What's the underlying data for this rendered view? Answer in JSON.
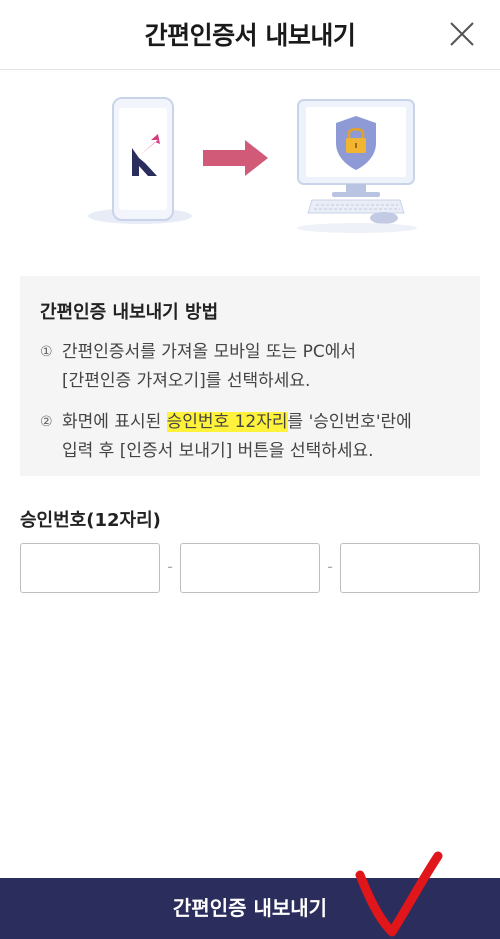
{
  "header": {
    "title": "간편인증서 내보내기",
    "close_icon": "close-icon"
  },
  "illustration": {
    "phone_logo_letter": "K",
    "arrow_icon": "arrow-right-icon",
    "computer_icon": "monitor-lock-icon",
    "colors": {
      "phone": "#eef2fb",
      "arrow": "#d05a78",
      "shield": "#8d9ad6",
      "lock": "#f1b532"
    }
  },
  "guide": {
    "title": "간편인증 내보내기 방법",
    "steps": [
      {
        "num": "①",
        "lines": [
          "간편인증서를 가져올 모바일 또는 PC에서",
          "[간편인증 가져오기]를 선택하세요."
        ]
      },
      {
        "num": "②",
        "line1_pre": "화면에 표시된 ",
        "line1_highlight": "승인번호 12자리",
        "line1_post": "를 '승인번호'란에",
        "line2": "입력 후 [인증서 보내기] 버튼을 선택하세요."
      }
    ]
  },
  "form": {
    "label": "승인번호(12자리)",
    "separator": "-",
    "inputs": [
      {
        "value": ""
      },
      {
        "value": ""
      },
      {
        "value": ""
      }
    ]
  },
  "footer": {
    "button_label": "간편인증 내보내기",
    "colors": {
      "button_bg": "#2b2d5c",
      "annotation": "#e0161b"
    }
  }
}
